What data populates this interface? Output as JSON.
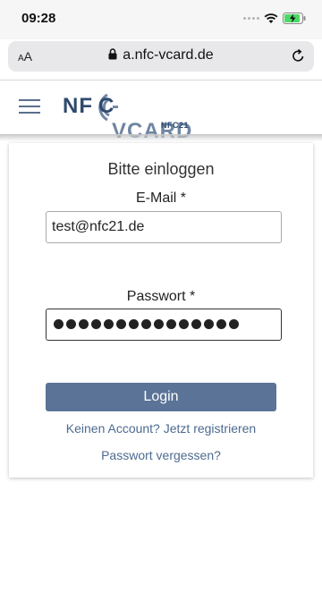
{
  "status_bar": {
    "time": "09:28"
  },
  "browser": {
    "text_size_label_small": "A",
    "text_size_label_large": "A",
    "url": "a.nfc-vcard.de"
  },
  "site_header": {
    "logo_nf": "NF",
    "logo_c": "C",
    "logo_vcard": "-VCARD",
    "logo_sub": "NFC21"
  },
  "login": {
    "title": "Bitte einloggen",
    "email_label": "E-Mail *",
    "email_value": "test@nfc21.de",
    "password_label": "Passwort *",
    "password_length": 15,
    "login_button": "Login",
    "register_link": "Keinen Account? Jetzt registrieren",
    "forgot_link": "Passwort vergessen?"
  },
  "colors": {
    "brand_dark": "#2f4a6e",
    "brand_light": "#6f86a3",
    "button_bg": "#5b7396",
    "link": "#4d6a91"
  }
}
